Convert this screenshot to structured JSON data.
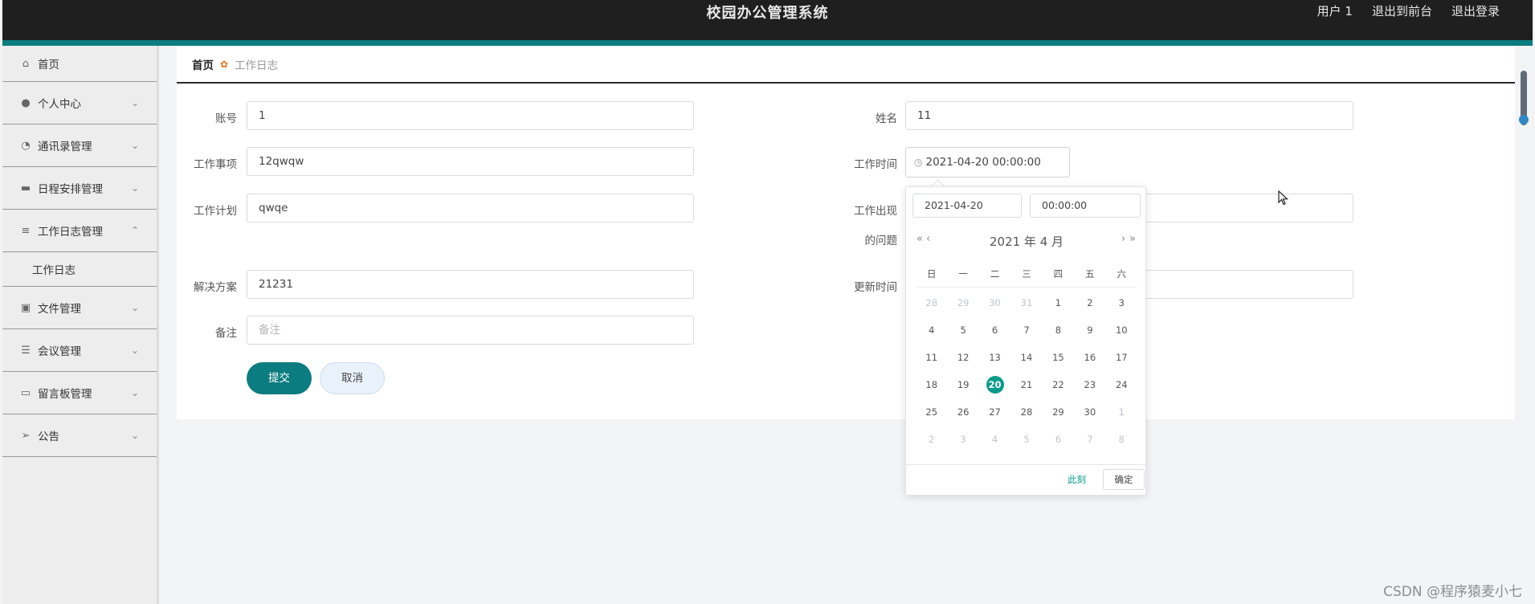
{
  "header": {
    "title": "校园办公管理系统",
    "links": [
      "用户 1",
      "退出到前台",
      "退出登录"
    ]
  },
  "sidebar": {
    "items": [
      {
        "label": "首页",
        "icon": "home-icon"
      },
      {
        "label": "个人中心",
        "icon": "user-icon"
      },
      {
        "label": "通讯录管理",
        "icon": "dashboard-icon"
      },
      {
        "label": "日程安排管理",
        "icon": "chat-icon"
      },
      {
        "label": "工作日志管理",
        "icon": "menu-icon",
        "expanded": true,
        "children": [
          "工作日志"
        ]
      },
      {
        "label": "文件管理",
        "icon": "document-icon"
      },
      {
        "label": "会议管理",
        "icon": "sliders-icon"
      },
      {
        "label": "留言板管理",
        "icon": "monitor-icon"
      },
      {
        "label": "公告",
        "icon": "send-icon"
      }
    ]
  },
  "breadcrumb": {
    "home": "首页",
    "current": "工作日志"
  },
  "form": {
    "account": {
      "label": "账号",
      "value": "1"
    },
    "name": {
      "label": "姓名",
      "value": "11"
    },
    "work_item": {
      "label": "工作事项",
      "value": "12qwqw"
    },
    "work_time": {
      "label": "工作时间",
      "value": "2021-04-20 00:00:00"
    },
    "work_plan": {
      "label": "工作计划",
      "value": "qwqe"
    },
    "problems": {
      "label_line1": "工作出现",
      "label_line2": "的问题"
    },
    "solution": {
      "label": "解决方案",
      "value": "21231"
    },
    "update_time": {
      "label": "更新时间"
    },
    "remark": {
      "label": "备注",
      "placeholder": "备注"
    },
    "submit": "提交",
    "cancel": "取消"
  },
  "datepicker": {
    "date_value": "2021-04-20",
    "time_value": "00:00:00",
    "header": "2021 年  4 月",
    "prev_year": "«",
    "prev_month": "‹",
    "next_month": "›",
    "next_year": "»",
    "weekdays": [
      "日",
      "一",
      "二",
      "三",
      "四",
      "五",
      "六"
    ],
    "days": [
      {
        "d": "28",
        "o": true
      },
      {
        "d": "29",
        "o": true
      },
      {
        "d": "30",
        "o": true
      },
      {
        "d": "31",
        "o": true
      },
      {
        "d": "1"
      },
      {
        "d": "2"
      },
      {
        "d": "3"
      },
      {
        "d": "4"
      },
      {
        "d": "5"
      },
      {
        "d": "6"
      },
      {
        "d": "7"
      },
      {
        "d": "8"
      },
      {
        "d": "9"
      },
      {
        "d": "10"
      },
      {
        "d": "11"
      },
      {
        "d": "12"
      },
      {
        "d": "13"
      },
      {
        "d": "14"
      },
      {
        "d": "15"
      },
      {
        "d": "16"
      },
      {
        "d": "17"
      },
      {
        "d": "18"
      },
      {
        "d": "19"
      },
      {
        "d": "20",
        "sel": true
      },
      {
        "d": "21"
      },
      {
        "d": "22"
      },
      {
        "d": "23"
      },
      {
        "d": "24"
      },
      {
        "d": "25"
      },
      {
        "d": "26"
      },
      {
        "d": "27"
      },
      {
        "d": "28"
      },
      {
        "d": "29"
      },
      {
        "d": "30"
      },
      {
        "d": "1",
        "o": true
      },
      {
        "d": "2",
        "o": true
      },
      {
        "d": "3",
        "o": true
      },
      {
        "d": "4",
        "o": true
      },
      {
        "d": "5",
        "o": true
      },
      {
        "d": "6",
        "o": true
      },
      {
        "d": "7",
        "o": true
      },
      {
        "d": "8",
        "o": true
      }
    ],
    "now": "此刻",
    "ok": "确定"
  },
  "watermark": "CSDN @程序猿麦小七",
  "colors": {
    "accent": "#0b7c80",
    "selected": "#0b9b8a",
    "topbar": "#1f1f1f"
  }
}
